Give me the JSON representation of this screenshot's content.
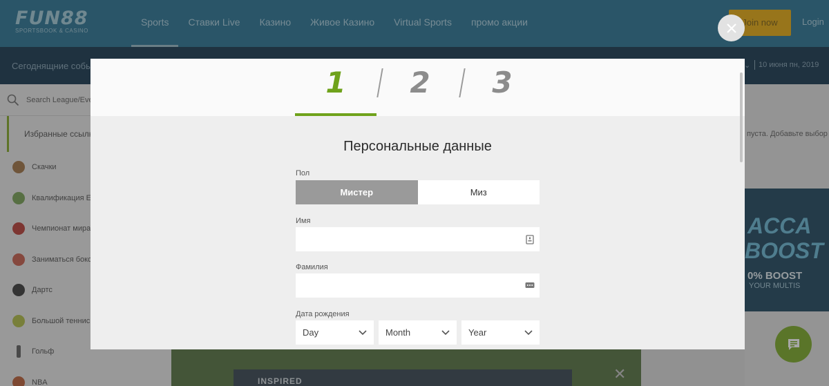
{
  "brand": {
    "name": "FUN88",
    "tagline": "SPORTSBOOK & CASINO"
  },
  "nav": {
    "items": [
      {
        "label": "Sports",
        "active": true
      },
      {
        "label": "Ставки Live"
      },
      {
        "label": "Казино"
      },
      {
        "label": "Живое Казино"
      },
      {
        "label": "Virtual Sports"
      },
      {
        "label": "промо акции"
      }
    ],
    "join_label": "Join now",
    "login_label": "Login"
  },
  "subbar": {
    "left_text": "Сегоднящние события",
    "date": "10 июня пн, 2019"
  },
  "sidebar": {
    "search_placeholder": "Search League/Event",
    "favorites_label": "Избранные ссылки",
    "items": [
      {
        "label": "Скачки",
        "icon": "horse-racing-icon",
        "color": "#9a6a3a"
      },
      {
        "label": "Квалификация Евро",
        "icon": "euro-qualifiers-icon",
        "color": "#6e9a4a"
      },
      {
        "label": "Чемпионат мира",
        "icon": "world-cup-icon",
        "color": "#b3322a"
      },
      {
        "label": "Заниматься боксом",
        "icon": "boxing-glove-icon",
        "color": "#c25340"
      },
      {
        "label": "Дартс",
        "icon": "darts-icon",
        "color": "#2e2e2e"
      },
      {
        "label": "Большой теннис",
        "icon": "tennis-ball-icon",
        "color": "#a9b63a"
      },
      {
        "label": "Гольф",
        "icon": "golf-club-icon",
        "color": "#555555"
      },
      {
        "label": "NBA",
        "icon": "basketball-icon",
        "color": "#b5542a"
      }
    ]
  },
  "right_panel": {
    "empty_message": "пуста. Добавьте выбор",
    "promo": {
      "line1": "ACCA",
      "line2": "BOOST",
      "line3": "0% BOOST",
      "line4": "YOUR MULTIS"
    }
  },
  "banner": {
    "text": "INSPIRED"
  },
  "modal": {
    "steps": [
      "1",
      "2",
      "3"
    ],
    "active_step": 1,
    "title": "Персональные данные",
    "gender_label": "Пол",
    "gender_options": [
      "Мистер",
      "Миз"
    ],
    "gender_selected": "Мистер",
    "first_name_label": "Имя",
    "first_name_value": "",
    "last_name_label": "Фамилия",
    "last_name_value": "",
    "dob_label": "Дата рождения",
    "dob_day": "Day",
    "dob_month": "Month",
    "dob_year": "Year"
  },
  "colors": {
    "accent_green": "#6fa21b",
    "topbar_blue": "#1d6a8c",
    "subbar_navy": "#092a44",
    "join_yellow": "#e3a400",
    "chat_green": "#74a51a"
  }
}
